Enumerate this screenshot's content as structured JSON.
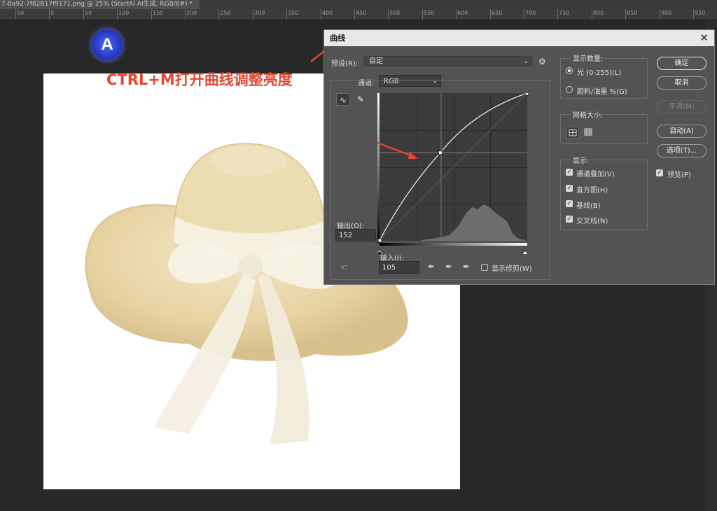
{
  "document_tab": {
    "title": "7-Ba92-7f82B17f9171.png @ 25% (StartAI AI生成, RGB/8#) *",
    "close": "×"
  },
  "ruler": {
    "labels": [
      "50",
      "0",
      "50",
      "100",
      "150",
      "200",
      "250",
      "300",
      "350",
      "400",
      "450",
      "500",
      "550",
      "600",
      "650",
      "700",
      "750",
      "800",
      "850",
      "900",
      "950"
    ]
  },
  "canvas": {
    "logo_letter": "A",
    "caption": "CTRL+M打开曲线调整亮度"
  },
  "dialog": {
    "title": "曲线",
    "close": "✕",
    "preset_label": "预设(R):",
    "preset_value": "自定",
    "channel_label": "通道:",
    "channel_value": "RGB",
    "output_label": "输出(O):",
    "output_value": "152",
    "input_label": "输入(I):",
    "input_value": "105",
    "show_clipping_label": "显示修剪(W)",
    "show_amount": {
      "title": "显示数量:",
      "light": "光 (0-255)(L)",
      "pigment": "颜料/油墨 %(G)",
      "selected": "light"
    },
    "grid_size": {
      "title": "网格大小:"
    },
    "show": {
      "title": "显示:",
      "items": [
        {
          "label": "通道叠加(V)",
          "checked": true
        },
        {
          "label": "直方图(H)",
          "checked": true
        },
        {
          "label": "基线(B)",
          "checked": true
        },
        {
          "label": "交叉线(N)",
          "checked": true
        }
      ]
    },
    "buttons": {
      "ok": "确定",
      "cancel": "取消",
      "smooth": "平滑(M)",
      "auto": "自动(A)",
      "options": "选项(T)..."
    },
    "preview": {
      "label": "预览(P)",
      "checked": true
    }
  },
  "curve": {
    "points": [
      [
        0,
        0
      ],
      [
        105,
        152
      ],
      [
        255,
        255
      ]
    ]
  },
  "colors": {
    "annotation_red": "#e8452e",
    "dialog_bg": "#535353",
    "app_bg": "#282828"
  }
}
